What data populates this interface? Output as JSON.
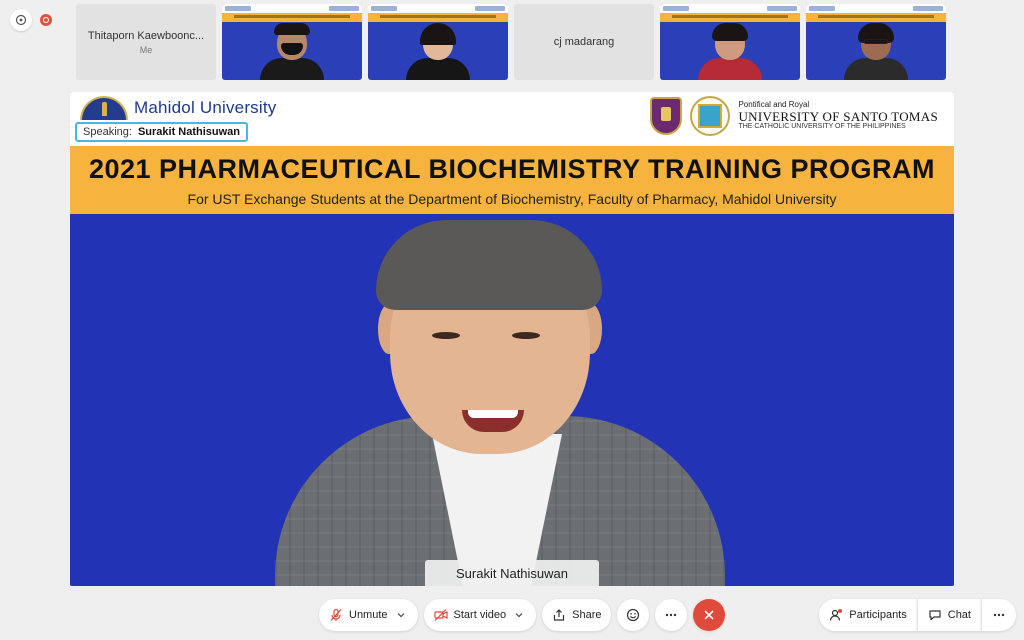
{
  "thumbnails": [
    {
      "name": "Thitaporn Kaewboonc...",
      "sub": "Me"
    },
    {
      "name": ""
    },
    {
      "name": ""
    },
    {
      "name": "cj madarang"
    },
    {
      "name": ""
    },
    {
      "name": ""
    }
  ],
  "stage": {
    "university_left": "Mahidol University",
    "speaking_label": "Speaking:",
    "speaking_name": "Surakit Nathisuwan",
    "ust_line1": "Pontifical and Royal",
    "ust_line2": "UNIVERSITY OF SANTO TOMAS",
    "ust_line3": "THE CATHOLIC UNIVERSITY OF THE PHILIPPINES",
    "banner_title": "2021 PHARMACEUTICAL BIOCHEMISTRY TRAINING PROGRAM",
    "banner_subtitle": "For UST Exchange Students at the Department of Biochemistry, Faculty of Pharmacy, Mahidol University",
    "speaker_name_tag": "Surakit Nathisuwan"
  },
  "toolbar": {
    "unmute": "Unmute",
    "start_video": "Start video",
    "share": "Share",
    "participants": "Participants",
    "chat": "Chat"
  },
  "colors": {
    "stage_blue": "#2233b6",
    "banner_orange": "#f6b33d",
    "end_call": "#e04a3a",
    "speaking_border": "#4fb3e8"
  }
}
